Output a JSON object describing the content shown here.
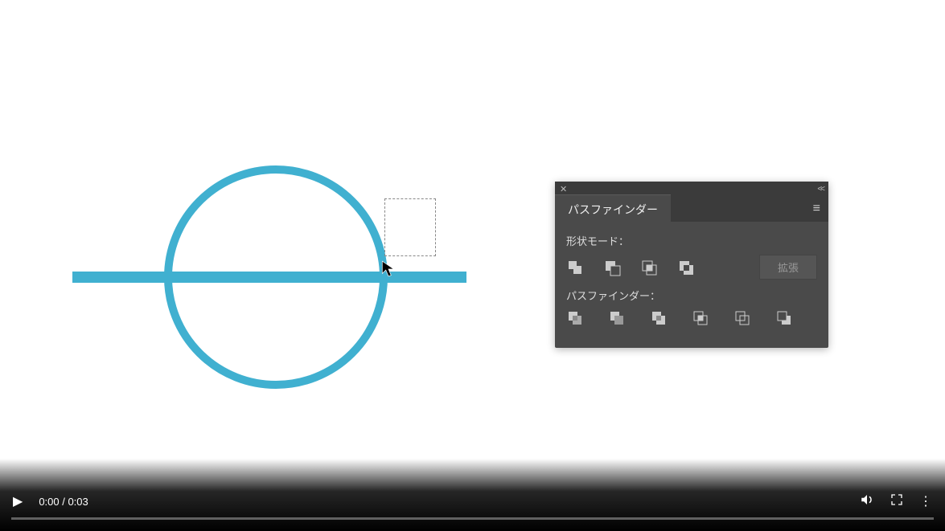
{
  "colors": {
    "shape": "#40b0d0",
    "panel_bg": "#4a4a4a"
  },
  "canvas": {
    "circle": {
      "stroke": "#40b0d0",
      "stroke_width": 10
    },
    "line": {
      "fill": "#40b0d0"
    }
  },
  "panel": {
    "title": "パスファインダー",
    "shape_modes_label": "形状モード：",
    "shape_modes": [
      {
        "name": "unite"
      },
      {
        "name": "minus-front"
      },
      {
        "name": "intersect"
      },
      {
        "name": "exclude"
      }
    ],
    "expand_label": "拡張",
    "pathfinder_label": "パスファインダー：",
    "pathfinders": [
      {
        "name": "divide"
      },
      {
        "name": "trim"
      },
      {
        "name": "merge"
      },
      {
        "name": "crop"
      },
      {
        "name": "outline"
      },
      {
        "name": "minus-back"
      }
    ]
  },
  "video": {
    "current_time": "0:00",
    "duration": "0:03",
    "time_display": "0:00 / 0:03",
    "progress_pct": 0
  }
}
